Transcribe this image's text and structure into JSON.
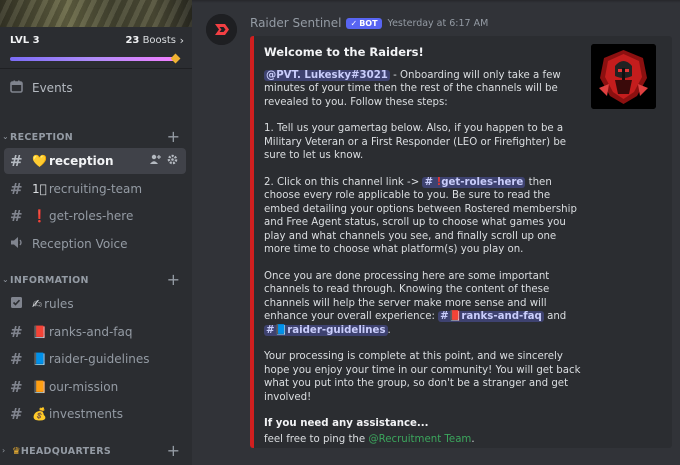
{
  "sidebar": {
    "level": "LVL 3",
    "boosts_count": "23",
    "boosts_label": "Boosts",
    "events_label": "Events",
    "categories": [
      {
        "label": "RECEPTION"
      },
      {
        "label": "INFORMATION"
      },
      {
        "label": "HEADQUARTERS"
      }
    ],
    "channels": [
      {
        "emoji": "💛",
        "label": "reception"
      },
      {
        "emoji": "1⃣",
        "label": "recruiting-team"
      },
      {
        "emoji": "❗",
        "label": "get-roles-here"
      },
      {
        "emoji": "",
        "label": "Reception Voice"
      },
      {
        "emoji": "✍",
        "label": "rules"
      },
      {
        "emoji": "📕",
        "label": "ranks-and-faq"
      },
      {
        "emoji": "📘",
        "label": "raider-guidelines"
      },
      {
        "emoji": "📙",
        "label": "our-mission"
      },
      {
        "emoji": "💰",
        "label": "investments"
      }
    ]
  },
  "message": {
    "author": "Raider Sentinel",
    "bot_badge": "BOT",
    "timestamp": "Yesterday at 6:17 AM",
    "embed": {
      "title": "Welcome to the Raiders!",
      "mention_user": "@PVT. Lukesky#3021",
      "p1_rest": " - Onboarding will only take a few minutes of your time then the rest of the channels will be revealed to you. Follow these steps:",
      "p2": "1. Tell us your gamertag below. Also, if you happen to be a Military Veteran or a First Responder (LEO or Firefighter) be sure to let us know.",
      "p3_before": "2. Click on this channel link -> ",
      "p3_channel": "get-roles-here",
      "p3_after": " then choose every role applicable to you. Be sure to read the embed detailing your options between Rostered membership and Free Agent status, scroll up to choose what games you play and what channels you see, and finally scroll up one more time to choose what platform(s) you play on.",
      "p4_before": "Once you are done processing here are some important channels to read through. Knowing the content of these channels will help the server make more sense and will enhance your overall experience: ",
      "p4_ch1": "ranks-and-faq",
      "p4_and": " and ",
      "p4_ch2": "raider-guidelines",
      "p4_end": ".",
      "p5": "Your processing is complete at this point, and we sincerely hope you enjoy your time in our community! You will get back what you put into the group, so don't be a stranger and get involved!",
      "assist_title": "If you need any assistance...",
      "assist_before": "feel free to ping the ",
      "assist_role": "@Recruitment Team",
      "assist_end": "."
    }
  },
  "colors": {
    "embed_accent": "#d01f1f",
    "mention_bg": "#3e4270",
    "role_green": "#3ba55c",
    "bot_badge": "#5865f2"
  },
  "icons": [
    "hashtag-icon",
    "calendar-icon",
    "speaker-icon",
    "rules-icon",
    "add-member-icon",
    "gear-icon",
    "plus-icon",
    "chevron-down-icon",
    "chevron-right-icon",
    "checkmark-icon",
    "crown-icon"
  ]
}
